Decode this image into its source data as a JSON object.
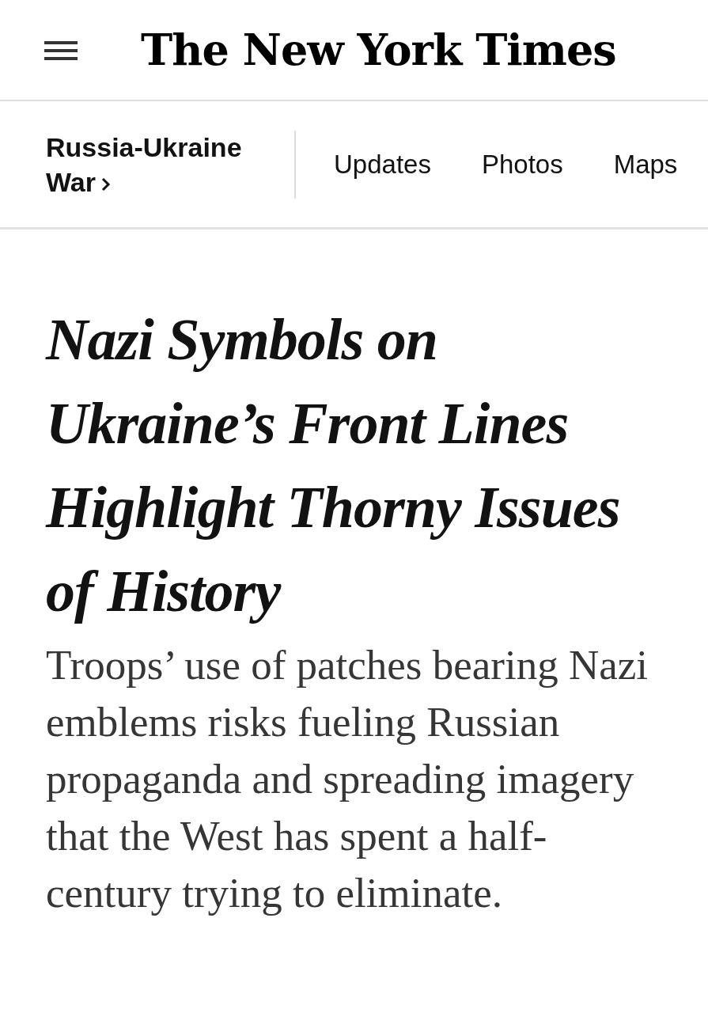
{
  "masthead": {
    "logo": "The New York Times"
  },
  "section_nav": {
    "section": "Russia-Ukraine War",
    "links": [
      {
        "label": "Updates"
      },
      {
        "label": "Photos"
      },
      {
        "label": "Maps"
      }
    ]
  },
  "article": {
    "headline": "Nazi Symbols on Ukraine’s Front Lines Highlight Thorny Issues of History",
    "summary": "Troops’ use of patches bearing Nazi emblems risks fueling Russian propaganda and spreading imagery that the West has spent a half-century trying to eliminate."
  }
}
